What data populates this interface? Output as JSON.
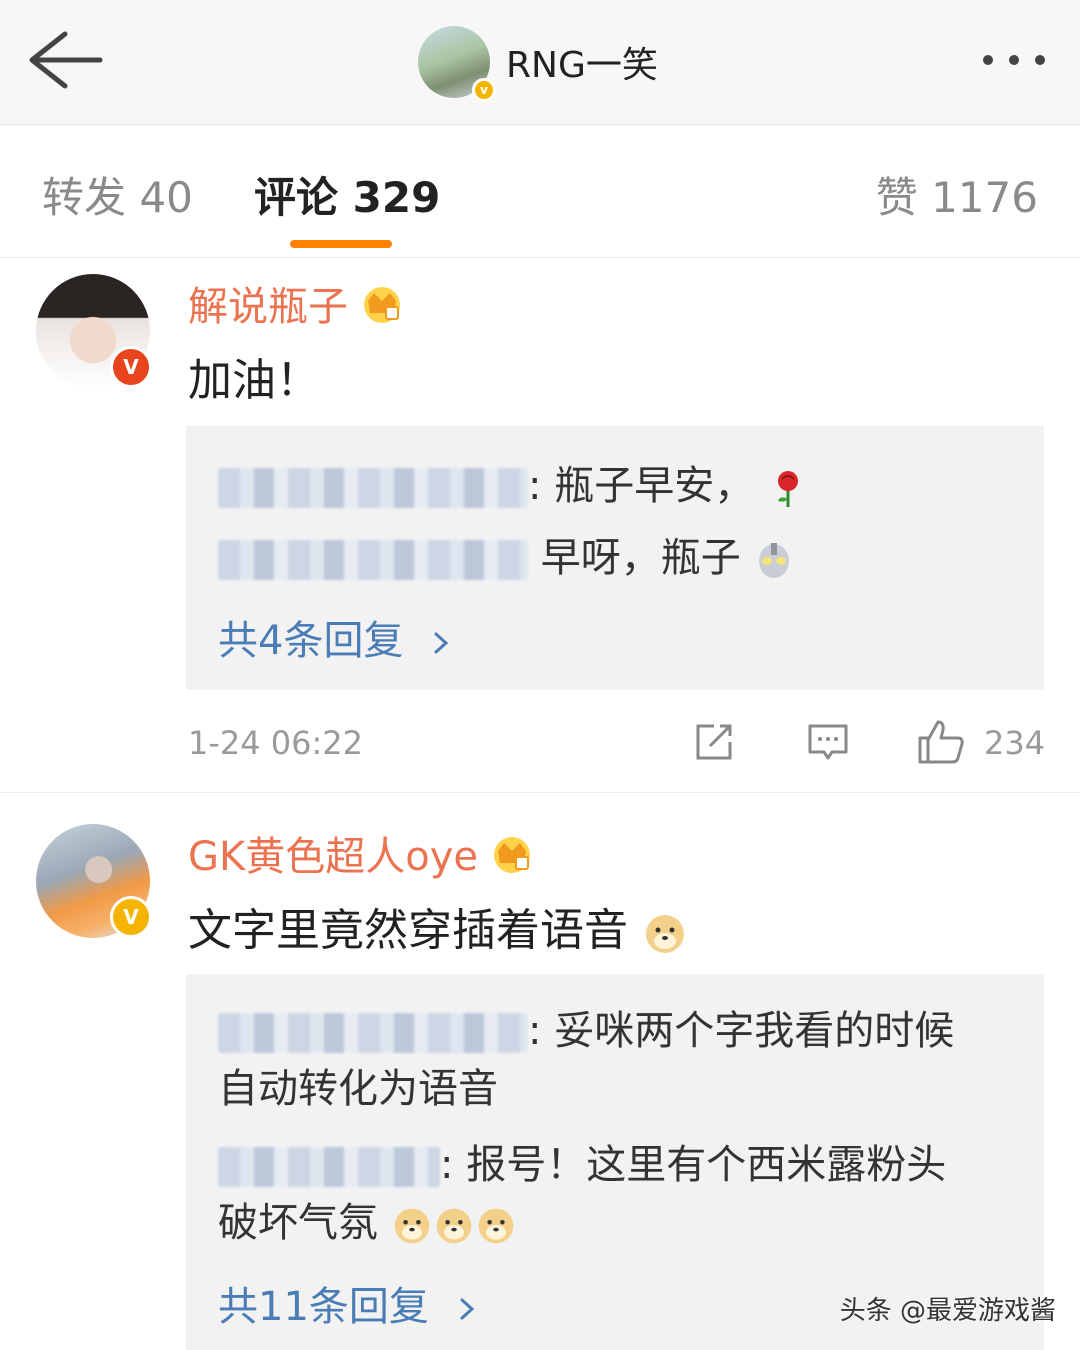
{
  "header": {
    "title": "RNG一笑"
  },
  "tabs": {
    "forward": "转发 40",
    "comment": "评论 329",
    "like": "赞 1176"
  },
  "comments": [
    {
      "username": "解说瓶子",
      "text": "加油！",
      "replies": [
        {
          "text": ": 瓶子早安，"
        },
        {
          "text": "早呀，瓶子"
        }
      ],
      "more_replies": "共4条回复",
      "time": "1-24 06:22",
      "likes": "234"
    },
    {
      "username": "GK黄色超人oye",
      "text": "文字里竟然穿插着语音",
      "replies": [
        {
          "text_line1": ": 妥咪两个字我看的时候",
          "text_line2": "自动转化为语音"
        },
        {
          "text_line1": ": 报号！这里有个西米露粉头",
          "text_line2": "破坏气氛"
        }
      ],
      "more_replies": "共11条回复"
    }
  ],
  "watermark": "头条 @最爱游戏酱",
  "colors": {
    "accent": "#ff8200",
    "username": "#eb7350",
    "link": "#4a7cb5",
    "verified": "#f5b400"
  },
  "icons": [
    "back-arrow-icon",
    "verified-icon",
    "more-icon",
    "crown-icon",
    "rose-icon",
    "ultraman-icon",
    "doge-icon",
    "share-icon",
    "comment-icon",
    "like-icon",
    "chevron-right-icon"
  ]
}
